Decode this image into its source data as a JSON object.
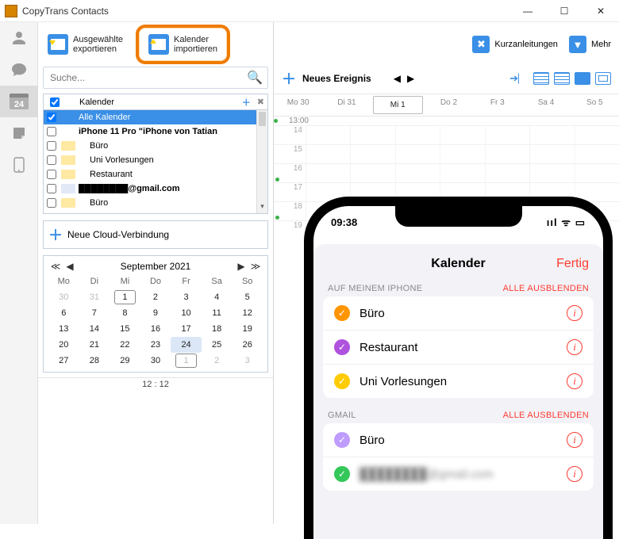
{
  "title": "CopyTrans Contacts",
  "rail": {
    "calendar_day": "24"
  },
  "toolbar": {
    "export_label": "Ausgewählte\nexportieren",
    "import_label": "Kalender\nimportieren",
    "quickguides_label": "Kurzanleitungen",
    "more_label": "Mehr"
  },
  "search": {
    "placeholder": "Suche..."
  },
  "cal_list": {
    "header": "Kalender",
    "items": [
      {
        "name": "Alle Kalender",
        "color": "#3a8fe6",
        "selected": true,
        "checked": true,
        "icon": ""
      },
      {
        "name": "iPhone 11 Pro \"iPhone von Tatian",
        "color": "",
        "bold": true,
        "indent": 0,
        "icon": "phone"
      },
      {
        "name": "Büro",
        "color": "#ffe9a3",
        "indent": 1
      },
      {
        "name": "Uni Vorlesungen",
        "color": "#ffe9a3",
        "indent": 1
      },
      {
        "name": "Restaurant",
        "color": "#ffe9a3",
        "indent": 1
      },
      {
        "name": "████████@gmail.com",
        "color": "#e3e8f7",
        "indent": 0,
        "bold": true,
        "icon": "mail"
      },
      {
        "name": "Büro",
        "color": "#ffe9a3",
        "indent": 1
      }
    ]
  },
  "cloud": {
    "label": "Neue Cloud-Verbindung"
  },
  "month": {
    "title": "September 2021",
    "dow": [
      "Mo",
      "Di",
      "Mi",
      "Do",
      "Fr",
      "Sa",
      "So"
    ],
    "rows": [
      [
        "30",
        "31",
        "1",
        "2",
        "3",
        "4",
        "5"
      ],
      [
        "6",
        "7",
        "8",
        "9",
        "10",
        "11",
        "12"
      ],
      [
        "13",
        "14",
        "15",
        "16",
        "17",
        "18",
        "19"
      ],
      [
        "20",
        "21",
        "22",
        "23",
        "24",
        "25",
        "26"
      ],
      [
        "27",
        "28",
        "29",
        "30",
        "1",
        "2",
        "3"
      ]
    ],
    "dim_prev": 2,
    "dim_next": 3,
    "ring_day": "1",
    "sel_day": "24",
    "clock": "12 : 12"
  },
  "right": {
    "new_event": "Neues Ereignis",
    "week": [
      "Mo 30",
      "Di 31",
      "Mi 1",
      "Do 2",
      "Fr 3",
      "Sa 4",
      "So 5"
    ],
    "sel_index": 2,
    "first_hour": "13:00",
    "hours": [
      "14",
      "15",
      "16",
      "17",
      "18",
      "19"
    ]
  },
  "phone": {
    "time": "09:38",
    "sheet_title": "Kalender",
    "done": "Fertig",
    "sec1": "AUF MEINEM IPHONE",
    "sec2": "GMAIL",
    "hide": "ALLE AUSBLENDEN",
    "local_cals": [
      {
        "name": "Büro",
        "color": "#ff9500"
      },
      {
        "name": "Restaurant",
        "color": "#af52de"
      },
      {
        "name": "Uni Vorlesungen",
        "color": "#ffcc00"
      }
    ],
    "gmail_cals": [
      {
        "name": "Büro",
        "color": "#bf9cff"
      },
      {
        "name": "████████@gmail.com",
        "color": "#34c759",
        "blur": true
      }
    ]
  }
}
